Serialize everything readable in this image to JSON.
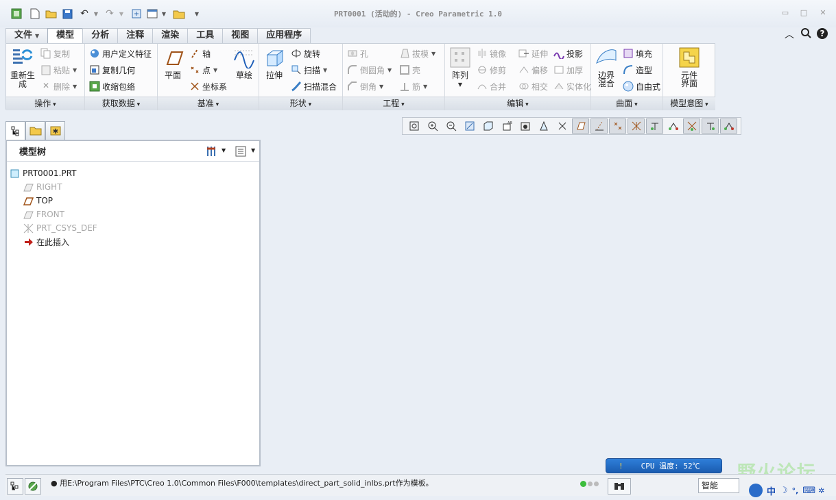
{
  "window": {
    "title": "PRT0001 (活动的) - Creo Parametric 1.0"
  },
  "tabs": [
    "文件",
    "模型",
    "分析",
    "注释",
    "渲染",
    "工具",
    "视图",
    "应用程序"
  ],
  "ribbon": {
    "operations": {
      "label": "操作",
      "regenerate": "重新生成",
      "copy": "复制",
      "paste": "粘贴",
      "delete": "删除"
    },
    "get_data": {
      "label": "获取数据",
      "udf": "用户定义特征",
      "copy_geom": "复制几何",
      "shrinkwrap": "收缩包络"
    },
    "datum": {
      "label": "基准",
      "plane": "平面",
      "axis": "轴",
      "point": "点",
      "csys": "坐标系",
      "sketch": "草绘"
    },
    "shapes": {
      "label": "形状",
      "extrude": "拉伸",
      "revolve": "旋转",
      "sweep": "扫描",
      "swept_blend": "扫描混合"
    },
    "engineering": {
      "label": "工程",
      "hole": "孔",
      "round": "倒圆角",
      "chamfer": "倒角",
      "draft": "拔模",
      "shell": "壳",
      "rib": "筋"
    },
    "editing": {
      "label": "编辑",
      "pattern": "阵列",
      "mirror": "镜像",
      "trim": "修剪",
      "merge": "合并",
      "extend": "延伸",
      "offset": "偏移",
      "intersect": "相交",
      "project": "投影",
      "thicken": "加厚",
      "solidify": "实体化"
    },
    "surfaces": {
      "label": "曲面",
      "boundary_blend": "边界混合",
      "fill": "填充",
      "style": "造型",
      "freestyle": "自由式"
    },
    "model_intent": {
      "label": "模型意图",
      "component_interface": "元件界面"
    }
  },
  "model_tree": {
    "title": "模型树",
    "items": [
      {
        "label": "PRT0001.PRT",
        "state": "normal",
        "icon": "part-icon"
      },
      {
        "label": "RIGHT",
        "state": "dim",
        "icon": "datum-plane-icon"
      },
      {
        "label": "TOP",
        "state": "normal",
        "icon": "datum-plane-icon"
      },
      {
        "label": "FRONT",
        "state": "dim",
        "icon": "datum-plane-icon"
      },
      {
        "label": "PRT_CSYS_DEF",
        "state": "dim",
        "icon": "csys-icon"
      },
      {
        "label": "在此插入",
        "state": "normal",
        "icon": "insert-arrow-icon"
      }
    ]
  },
  "status": {
    "message": "用E:\\Program Files\\PTC\\Creo 1.0\\Common Files\\F000\\templates\\direct_part_solid_inlbs.prt作为模板。",
    "filter": "智能"
  },
  "overlay": {
    "cpu_temp": "CPU 温度: 52℃",
    "watermark": "野火论坛",
    "ime": "中"
  },
  "colors": {
    "accent": "#1b5cb0",
    "ribbon_bg": "#fbfbfc",
    "canvas_bg": "#e9eef5"
  }
}
